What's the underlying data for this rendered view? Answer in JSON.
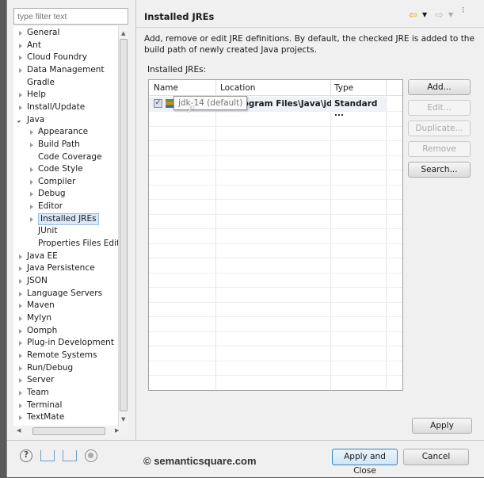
{
  "filter": {
    "placeholder": "type filter text"
  },
  "tree": [
    {
      "label": "General",
      "level": 0,
      "arrow": "closed"
    },
    {
      "label": "Ant",
      "level": 0,
      "arrow": "closed"
    },
    {
      "label": "Cloud Foundry",
      "level": 0,
      "arrow": "closed"
    },
    {
      "label": "Data Management",
      "level": 0,
      "arrow": "closed"
    },
    {
      "label": "Gradle",
      "level": 0,
      "arrow": "none"
    },
    {
      "label": "Help",
      "level": 0,
      "arrow": "closed"
    },
    {
      "label": "Install/Update",
      "level": 0,
      "arrow": "closed"
    },
    {
      "label": "Java",
      "level": 0,
      "arrow": "open"
    },
    {
      "label": "Appearance",
      "level": 1,
      "arrow": "closed"
    },
    {
      "label": "Build Path",
      "level": 1,
      "arrow": "closed"
    },
    {
      "label": "Code Coverage",
      "level": 1,
      "arrow": "none"
    },
    {
      "label": "Code Style",
      "level": 1,
      "arrow": "closed"
    },
    {
      "label": "Compiler",
      "level": 1,
      "arrow": "closed"
    },
    {
      "label": "Debug",
      "level": 1,
      "arrow": "closed"
    },
    {
      "label": "Editor",
      "level": 1,
      "arrow": "closed"
    },
    {
      "label": "Installed JREs",
      "level": 1,
      "arrow": "closed",
      "selected": true
    },
    {
      "label": "JUnit",
      "level": 1,
      "arrow": "none"
    },
    {
      "label": "Properties Files Editor",
      "level": 1,
      "arrow": "none"
    },
    {
      "label": "Java EE",
      "level": 0,
      "arrow": "closed"
    },
    {
      "label": "Java Persistence",
      "level": 0,
      "arrow": "closed"
    },
    {
      "label": "JSON",
      "level": 0,
      "arrow": "closed"
    },
    {
      "label": "Language Servers",
      "level": 0,
      "arrow": "closed"
    },
    {
      "label": "Maven",
      "level": 0,
      "arrow": "closed"
    },
    {
      "label": "Mylyn",
      "level": 0,
      "arrow": "closed"
    },
    {
      "label": "Oomph",
      "level": 0,
      "arrow": "closed"
    },
    {
      "label": "Plug-in Development",
      "level": 0,
      "arrow": "closed"
    },
    {
      "label": "Remote Systems",
      "level": 0,
      "arrow": "closed"
    },
    {
      "label": "Run/Debug",
      "level": 0,
      "arrow": "closed"
    },
    {
      "label": "Server",
      "level": 0,
      "arrow": "closed"
    },
    {
      "label": "Team",
      "level": 0,
      "arrow": "closed"
    },
    {
      "label": "Terminal",
      "level": 0,
      "arrow": "closed"
    },
    {
      "label": "TextMate",
      "level": 0,
      "arrow": "closed"
    }
  ],
  "page": {
    "title": "Installed JREs",
    "description": "Add, remove or edit JRE definitions. By default, the checked JRE is added to the build path of newly created Java projects.",
    "table_label": "Installed JREs:",
    "columns": [
      "Name",
      "Location",
      "Type"
    ],
    "rows": [
      {
        "checked": true,
        "name": "jdk-14 (default)",
        "location": "C:\\Program Files\\Java\\jdk...",
        "type": "Standard ..."
      }
    ],
    "tooltip": "jdk-14 (default)",
    "buttons": {
      "add": "Add...",
      "edit": "Edit...",
      "duplicate": "Duplicate...",
      "remove": "Remove",
      "search": "Search..."
    },
    "apply": "Apply"
  },
  "footer": {
    "watermark": "© semanticsquare.com",
    "apply_close": "Apply and Close",
    "cancel": "Cancel"
  },
  "colors": {
    "accent": "#3c7fb1",
    "selection": "#dbe8f7"
  }
}
